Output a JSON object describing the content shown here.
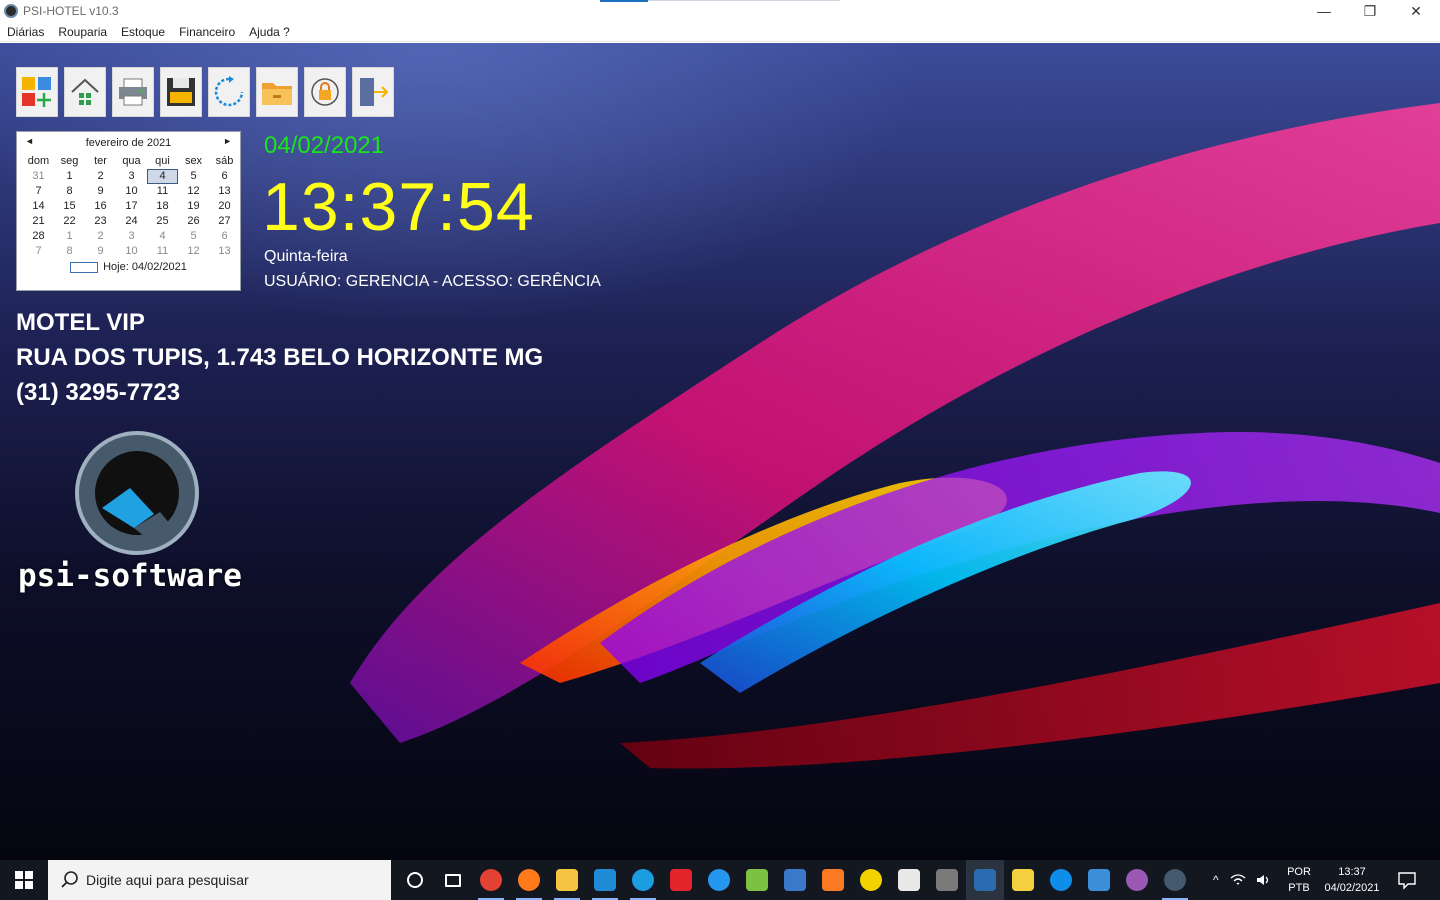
{
  "window": {
    "title": "PSI-HOTEL v10.3",
    "minimize": "—",
    "maximize": "❐",
    "close": "✕"
  },
  "menu": [
    "Diárias",
    "Rouparia",
    "Estoque",
    "Financeiro",
    "Ajuda ?"
  ],
  "toolbar": [
    {
      "name": "new-icon"
    },
    {
      "name": "home-icon"
    },
    {
      "name": "printer-icon"
    },
    {
      "name": "save-icon"
    },
    {
      "name": "refresh-icon"
    },
    {
      "name": "folder-icon"
    },
    {
      "name": "lock-icon"
    },
    {
      "name": "exit-icon"
    }
  ],
  "calendar": {
    "month_label": "fevereiro de 2021",
    "prev": "◄",
    "next": "►",
    "dows": [
      "dom",
      "seg",
      "ter",
      "qua",
      "qui",
      "sex",
      "sáb"
    ],
    "weeks": [
      [
        {
          "d": "31",
          "m": true
        },
        {
          "d": "1"
        },
        {
          "d": "2"
        },
        {
          "d": "3"
        },
        {
          "d": "4",
          "sel": true
        },
        {
          "d": "5"
        },
        {
          "d": "6"
        }
      ],
      [
        {
          "d": "7"
        },
        {
          "d": "8"
        },
        {
          "d": "9"
        },
        {
          "d": "10"
        },
        {
          "d": "11"
        },
        {
          "d": "12"
        },
        {
          "d": "13"
        }
      ],
      [
        {
          "d": "14"
        },
        {
          "d": "15"
        },
        {
          "d": "16"
        },
        {
          "d": "17"
        },
        {
          "d": "18"
        },
        {
          "d": "19"
        },
        {
          "d": "20"
        }
      ],
      [
        {
          "d": "21"
        },
        {
          "d": "22"
        },
        {
          "d": "23"
        },
        {
          "d": "24"
        },
        {
          "d": "25"
        },
        {
          "d": "26"
        },
        {
          "d": "27"
        }
      ],
      [
        {
          "d": "28"
        },
        {
          "d": "1",
          "m": true
        },
        {
          "d": "2",
          "m": true
        },
        {
          "d": "3",
          "m": true
        },
        {
          "d": "4",
          "m": true
        },
        {
          "d": "5",
          "m": true
        },
        {
          "d": "6",
          "m": true
        }
      ],
      [
        {
          "d": "7",
          "m": true
        },
        {
          "d": "8",
          "m": true
        },
        {
          "d": "9",
          "m": true
        },
        {
          "d": "10",
          "m": true
        },
        {
          "d": "11",
          "m": true
        },
        {
          "d": "12",
          "m": true
        },
        {
          "d": "13",
          "m": true
        }
      ]
    ],
    "today_label": "Hoje: 04/02/2021"
  },
  "clock": {
    "date": "04/02/2021",
    "time": "13:37:54",
    "weekday": "Quinta-feira",
    "user_line": "USUÁRIO: GERENCIA - ACESSO: GERÊNCIA",
    "date_color": "#19e619",
    "time_color": "#ffff1a"
  },
  "company": {
    "name": "MOTEL VIP",
    "address": "RUA DOS TUPIS, 1.743 BELO HORIZONTE MG",
    "phone": "(31) 3295-7723"
  },
  "logo": {
    "text": "psi-software"
  },
  "taskbar": {
    "search_placeholder": "Digite aqui para pesquisar",
    "apps": [
      {
        "name": "cortana-icon",
        "color": "#121720"
      },
      {
        "name": "task-view-icon",
        "color": "#121720"
      },
      {
        "name": "chrome-icon",
        "color": "#e34133",
        "open": true
      },
      {
        "name": "firefox-icon",
        "color": "#ff7a1a",
        "open": true
      },
      {
        "name": "file-explorer-icon",
        "color": "#f5c542",
        "open": true
      },
      {
        "name": "vscode-icon",
        "color": "#1f8ad6",
        "open": true
      },
      {
        "name": "edge-icon",
        "color": "#1b9de2",
        "open": true
      },
      {
        "name": "devexpress-icon",
        "color": "#e3242b"
      },
      {
        "name": "docker-icon",
        "color": "#2496ed"
      },
      {
        "name": "notepad-plus-icon",
        "color": "#7cc242"
      },
      {
        "name": "window-app-icon",
        "color": "#3a78c9"
      },
      {
        "name": "xampp-icon",
        "color": "#fb7a24"
      },
      {
        "name": "python-app-icon",
        "color": "#f2d200"
      },
      {
        "name": "file-icon",
        "color": "#e8e8e8"
      },
      {
        "name": "calculator-icon",
        "color": "#7a7a7a"
      },
      {
        "name": "psi-app-icon",
        "color": "#2b6cb0",
        "active": true
      },
      {
        "name": "sticky-notes-icon",
        "color": "#f4d03f"
      },
      {
        "name": "teamviewer-icon",
        "color": "#0e8ee9"
      },
      {
        "name": "photos-icon",
        "color": "#3a8fd6"
      },
      {
        "name": "github-icon",
        "color": "#9b59b6"
      },
      {
        "name": "psi-hotel-icon",
        "color": "#44596e",
        "open": true
      }
    ],
    "tray_chevron": "^",
    "lang1": "POR",
    "lang2": "PTB",
    "time": "13:37",
    "date": "04/02/2021"
  }
}
